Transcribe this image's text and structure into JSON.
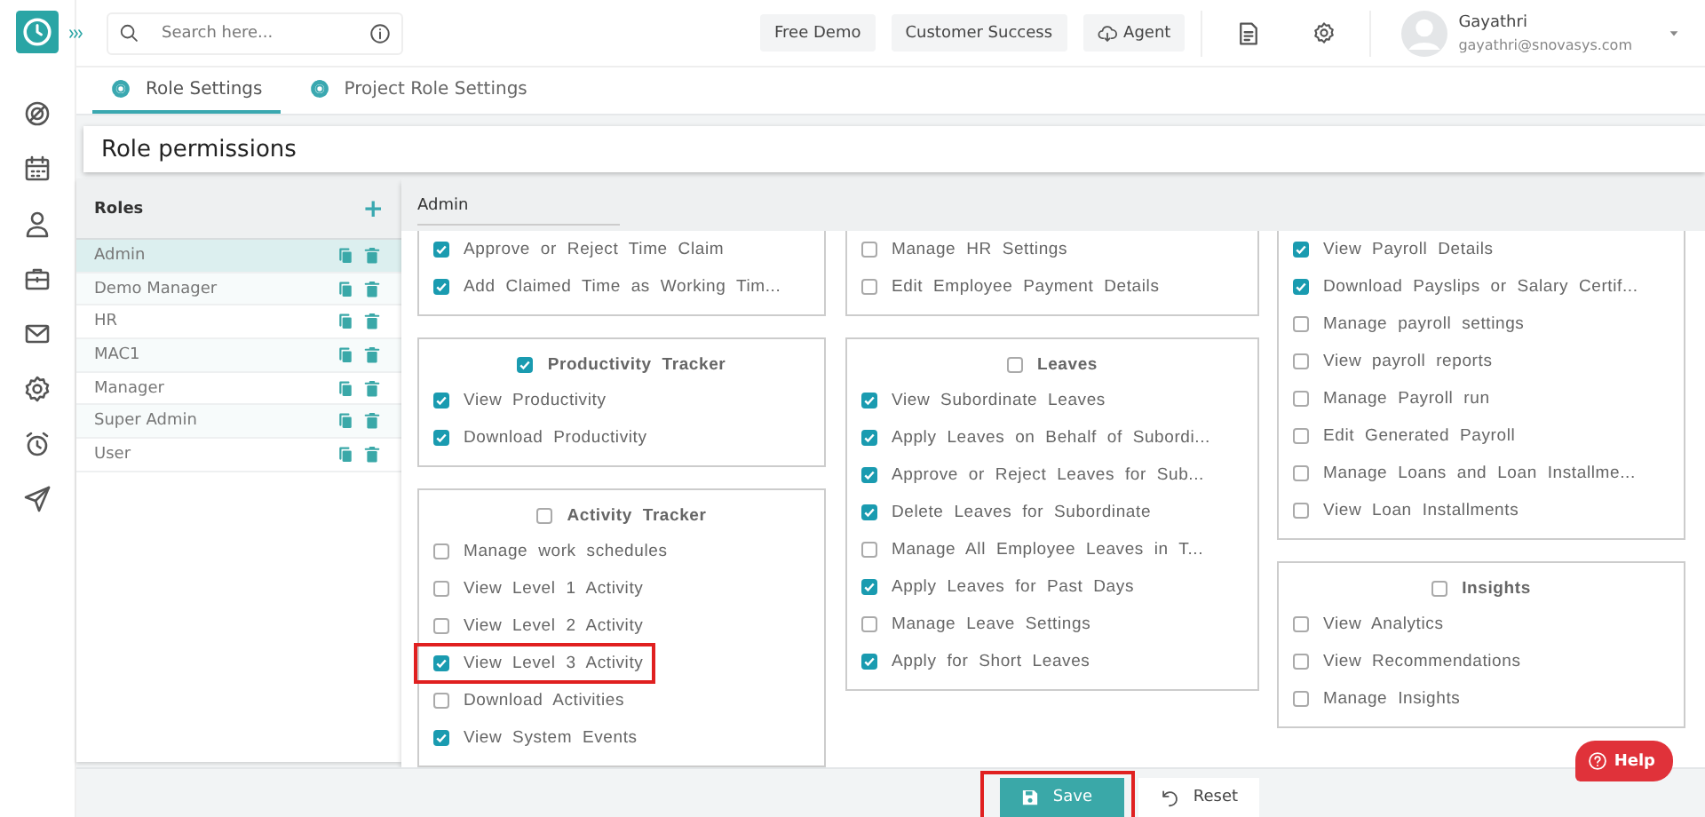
{
  "search": {
    "placeholder": "Search here..."
  },
  "top_buttons": [
    {
      "label": "Free Demo",
      "kind": "plain"
    },
    {
      "label": "Customer Success",
      "kind": "plain"
    },
    {
      "label": "Agent",
      "kind": "cloud"
    }
  ],
  "user": {
    "name": "Gayathri",
    "email": "gayathri@snovasys.com"
  },
  "tabs": [
    {
      "label": "Role Settings",
      "selected": true
    },
    {
      "label": "Project Role Settings",
      "selected": false
    }
  ],
  "page_title": "Role permissions",
  "roles": {
    "title": "Roles",
    "add": "+",
    "items": [
      {
        "name": "Admin",
        "selected": true
      },
      {
        "name": "Demo Manager",
        "selected": false
      },
      {
        "name": "HR",
        "selected": false
      },
      {
        "name": "MAC1",
        "selected": false
      },
      {
        "name": "Manager",
        "selected": false
      },
      {
        "name": "Super Admin",
        "selected": false
      },
      {
        "name": "User",
        "selected": false
      }
    ]
  },
  "role_name": "Admin",
  "permission_columns": [
    [
      {
        "items": [
          {
            "label": "Approve or Reject Time Claim",
            "checked": true,
            "highlighted": false
          },
          {
            "label": "Add Claimed Time as Working Tim...",
            "checked": true,
            "highlighted": false
          }
        ]
      },
      {
        "title": "Productivity Tracker",
        "checked": true,
        "items": [
          {
            "label": "View Productivity",
            "checked": true,
            "highlighted": false
          },
          {
            "label": "Download Productivity",
            "checked": true,
            "highlighted": false
          }
        ]
      },
      {
        "title": "Activity Tracker",
        "checked": false,
        "items": [
          {
            "label": "Manage work schedules",
            "checked": false,
            "highlighted": false
          },
          {
            "label": "View Level 1 Activity",
            "checked": false,
            "highlighted": false
          },
          {
            "label": "View Level 2 Activity",
            "checked": false,
            "highlighted": false
          },
          {
            "label": "View Level 3 Activity",
            "checked": true,
            "highlighted": true
          },
          {
            "label": "Download Activities",
            "checked": false,
            "highlighted": false
          },
          {
            "label": "View System Events",
            "checked": true,
            "highlighted": false
          }
        ]
      }
    ],
    [
      {
        "items": [
          {
            "label": "Manage HR Settings",
            "checked": false,
            "highlighted": false
          },
          {
            "label": "Edit Employee Payment Details",
            "checked": false,
            "highlighted": false
          }
        ]
      },
      {
        "title": "Leaves",
        "checked": false,
        "items": [
          {
            "label": "View Subordinate Leaves",
            "checked": true,
            "highlighted": false
          },
          {
            "label": "Apply Leaves on Behalf of Subordi...",
            "checked": true,
            "highlighted": false
          },
          {
            "label": "Approve or Reject Leaves for Sub...",
            "checked": true,
            "highlighted": false
          },
          {
            "label": "Delete Leaves for Subordinate",
            "checked": true,
            "highlighted": false
          },
          {
            "label": "Manage All Employee Leaves in T...",
            "checked": false,
            "highlighted": false
          },
          {
            "label": "Apply Leaves for Past Days",
            "checked": true,
            "highlighted": false
          },
          {
            "label": "Manage Leave Settings",
            "checked": false,
            "highlighted": false
          },
          {
            "label": "Apply for Short Leaves",
            "checked": true,
            "highlighted": false
          }
        ]
      }
    ],
    [
      {
        "items": [
          {
            "label": "View Payroll Details",
            "checked": true,
            "highlighted": false
          },
          {
            "label": "Download Payslips or Salary Certif...",
            "checked": true,
            "highlighted": false
          },
          {
            "label": "Manage payroll settings",
            "checked": false,
            "highlighted": false
          },
          {
            "label": "View payroll reports",
            "checked": false,
            "highlighted": false
          },
          {
            "label": "Manage Payroll run",
            "checked": false,
            "highlighted": false
          },
          {
            "label": "Edit Generated Payroll",
            "checked": false,
            "highlighted": false
          },
          {
            "label": "Manage Loans and Loan Installme...",
            "checked": false,
            "highlighted": false
          },
          {
            "label": "View Loan Installments",
            "checked": false,
            "highlighted": false
          }
        ]
      },
      {
        "title": "Insights",
        "checked": false,
        "items": [
          {
            "label": "View Analytics",
            "checked": false,
            "highlighted": false
          },
          {
            "label": "View Recommendations",
            "checked": false,
            "highlighted": false
          },
          {
            "label": "Manage Insights",
            "checked": false,
            "highlighted": false
          }
        ]
      }
    ]
  ],
  "help": "Help",
  "actions": [
    {
      "label": "Save",
      "kind": "save",
      "highlighted": true
    },
    {
      "label": "Reset",
      "kind": "reset",
      "highlighted": false
    }
  ]
}
